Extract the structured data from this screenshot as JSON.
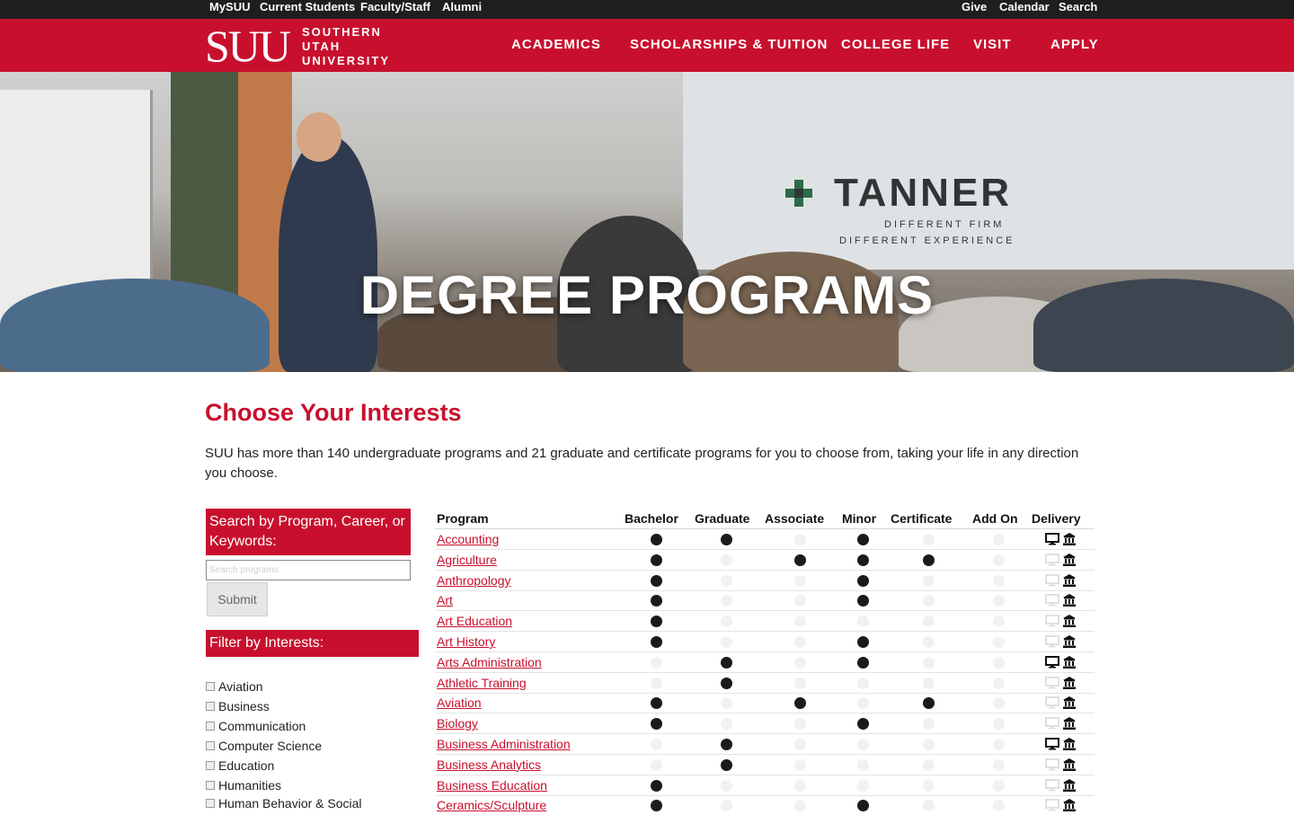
{
  "utility": {
    "left": [
      "MySUU",
      "Current Students",
      "Faculty/Staff",
      "Alumni"
    ],
    "right": [
      "Give",
      "Calendar",
      "Search"
    ]
  },
  "logo": {
    "mark": "SUU",
    "line1": "SOUTHERN",
    "line2": "UTAH",
    "line3": "UNIVERSITY"
  },
  "nav": [
    "ACADEMICS",
    "SCHOLARSHIPS & TUITION",
    "COLLEGE LIFE",
    "VISIT",
    "APPLY"
  ],
  "hero": {
    "title": "DEGREE PROGRAMS",
    "sign_brand": "TANNER",
    "sign_line1": "DIFFERENT FIRM",
    "sign_line2": "DIFFERENT EXPERIENCE"
  },
  "main": {
    "heading": "Choose Your Interests",
    "intro": "SUU has more than 140 undergraduate programs and 21 graduate and certificate programs for you to choose from, taking your life in any direction you choose."
  },
  "search": {
    "heading": "Search by Program, Career, or Keywords:",
    "placeholder": "Search programs",
    "submit": "Submit"
  },
  "filter": {
    "heading": "Filter by Interests:",
    "items": [
      "Aviation",
      "Business",
      "Communication",
      "Computer Science",
      "Education",
      "Humanities",
      "Human Behavior & Social Sciences"
    ]
  },
  "table": {
    "headers": [
      "Program",
      "Bachelor",
      "Graduate",
      "Associate",
      "Minor",
      "Certificate",
      "Add On",
      "Delivery"
    ],
    "rows": [
      {
        "program": "Accounting",
        "offered": [
          1,
          1,
          0,
          1,
          0,
          0
        ],
        "online": true
      },
      {
        "program": "Agriculture",
        "offered": [
          1,
          0,
          1,
          1,
          1,
          0
        ],
        "online": false
      },
      {
        "program": "Anthropology",
        "offered": [
          1,
          0,
          0,
          1,
          0,
          0
        ],
        "online": false
      },
      {
        "program": "Art",
        "offered": [
          1,
          0,
          0,
          1,
          0,
          0
        ],
        "online": false
      },
      {
        "program": "Art Education",
        "offered": [
          1,
          0,
          0,
          0,
          0,
          0
        ],
        "online": false
      },
      {
        "program": "Art History",
        "offered": [
          1,
          0,
          0,
          1,
          0,
          0
        ],
        "online": false
      },
      {
        "program": "Arts Administration",
        "offered": [
          0,
          1,
          0,
          1,
          0,
          0
        ],
        "online": true
      },
      {
        "program": "Athletic Training",
        "offered": [
          0,
          1,
          0,
          0,
          0,
          0
        ],
        "online": false
      },
      {
        "program": "Aviation",
        "offered": [
          1,
          0,
          1,
          0,
          1,
          0
        ],
        "online": false
      },
      {
        "program": "Biology",
        "offered": [
          1,
          0,
          0,
          1,
          0,
          0
        ],
        "online": false
      },
      {
        "program": "Business Administration",
        "offered": [
          0,
          1,
          0,
          0,
          0,
          0
        ],
        "online": true
      },
      {
        "program": "Business Analytics",
        "offered": [
          0,
          1,
          0,
          0,
          0,
          0
        ],
        "online": false
      },
      {
        "program": "Business Education",
        "offered": [
          1,
          0,
          0,
          0,
          0,
          0
        ],
        "online": false
      },
      {
        "program": "Ceramics/Sculpture",
        "offered": [
          1,
          0,
          0,
          1,
          0,
          0
        ],
        "online": false
      }
    ]
  },
  "colors": {
    "brand_red": "#c8102e",
    "utility_bar": "#1e1e1e",
    "dot_on": "#1b1b1b",
    "dot_off": "#f1f1f1"
  },
  "icons": {
    "online": "monitor-icon",
    "campus": "campus-building-icon"
  }
}
